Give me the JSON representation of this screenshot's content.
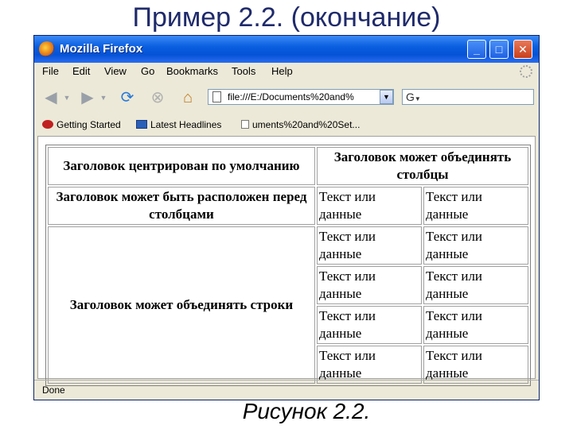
{
  "slide": {
    "title": "Пример 2.2. (окончание)",
    "caption": "Рисунок 2.2."
  },
  "window": {
    "title": "Mozilla Firefox",
    "buttons": {
      "minimize": "_",
      "maximize": "□",
      "close": "✕"
    }
  },
  "menu": {
    "items": [
      "File",
      "Edit",
      "View",
      "Go",
      "Bookmarks",
      "Tools",
      "Help"
    ]
  },
  "toolbar": {
    "url": "file:///E:/Documents%20and%",
    "search_glyph": "G"
  },
  "bookmarks": {
    "items": [
      "Getting Started",
      "Latest Headlines",
      "uments%20and%20Set..."
    ]
  },
  "table": {
    "header_row": [
      "Заголовок центрирован по умолчанию",
      "Заголовок может объединять столбцы"
    ],
    "row2_header": "Заголовок может быть расположен перед столбцами",
    "rowspan_header": "Заголовок может объединять строки",
    "cell_text": "Текст или данные"
  },
  "status": {
    "text": "Done"
  },
  "colors": {
    "titlebar": "#0552d6",
    "slide_title": "#1f2a6b"
  }
}
